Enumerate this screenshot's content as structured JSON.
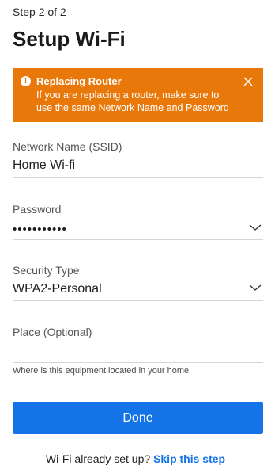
{
  "header": {
    "step": "Step 2 of 2",
    "title": "Setup Wi-Fi"
  },
  "banner": {
    "icon": "warning-icon",
    "title": "Replacing Router",
    "message": "If you are replacing a router, make sure to use the same Network Name and Password",
    "color": "#e9780b"
  },
  "form": {
    "ssid": {
      "label": "Network Name (SSID)",
      "value": "Home Wi-fi"
    },
    "password": {
      "label": "Password",
      "value": "•••••••••••"
    },
    "security": {
      "label": "Security Type",
      "value": "WPA2-Personal"
    },
    "place": {
      "label": "Place (Optional)",
      "value": "",
      "hint": "Where is this equipment located in your home"
    }
  },
  "actions": {
    "done_label": "Done",
    "done_color": "#1473e6"
  },
  "footer": {
    "prompt": "Wi-Fi already set up?",
    "skip_label": "Skip this step"
  }
}
